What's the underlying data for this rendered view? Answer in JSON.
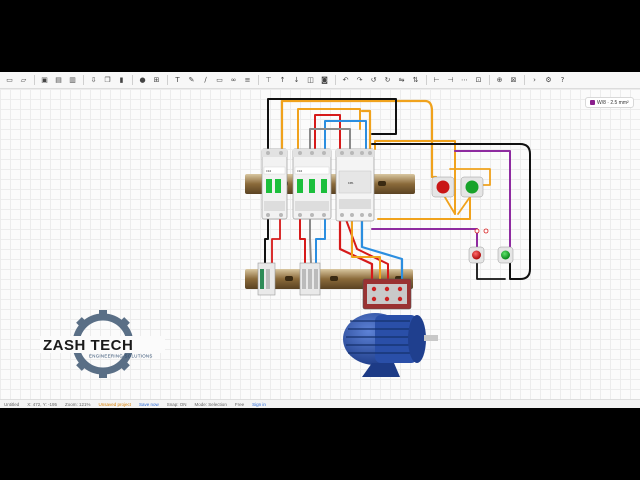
{
  "toolbar": {
    "buttons": [
      {
        "icon": "new-file-icon",
        "glyph": "▭"
      },
      {
        "icon": "open-folder-icon",
        "glyph": "▱"
      },
      {
        "icon": "save-icon",
        "glyph": "▣"
      },
      {
        "icon": "save-as-icon",
        "glyph": "▤"
      },
      {
        "icon": "export-icon",
        "glyph": "▥"
      },
      {
        "icon": "download-icon",
        "glyph": "⇩"
      },
      {
        "icon": "copy-icon",
        "glyph": "❐"
      },
      {
        "icon": "delete-icon",
        "glyph": "▮"
      },
      {
        "icon": "add-component-icon",
        "glyph": "●"
      },
      {
        "icon": "grid-icon",
        "glyph": "⊞"
      },
      {
        "icon": "text-tool-icon",
        "glyph": "T"
      },
      {
        "icon": "pen-tool-icon",
        "glyph": "✎"
      },
      {
        "icon": "line-tool-icon",
        "glyph": "∕"
      },
      {
        "icon": "shape-tool-icon",
        "glyph": "▭"
      },
      {
        "icon": "link-icon",
        "glyph": "∞"
      },
      {
        "icon": "layers-icon",
        "glyph": "≡"
      },
      {
        "icon": "filter-icon",
        "glyph": "⊤"
      },
      {
        "icon": "bring-forward-icon",
        "glyph": "↑"
      },
      {
        "icon": "send-backward-icon",
        "glyph": "↓"
      },
      {
        "icon": "unlock-icon",
        "glyph": "◫"
      },
      {
        "icon": "lock-icon",
        "glyph": "◙"
      },
      {
        "icon": "undo-icon",
        "glyph": "↶"
      },
      {
        "icon": "redo-icon",
        "glyph": "↷"
      },
      {
        "icon": "rotate-left-icon",
        "glyph": "↺"
      },
      {
        "icon": "rotate-right-icon",
        "glyph": "↻"
      },
      {
        "icon": "flip-horizontal-icon",
        "glyph": "⇋"
      },
      {
        "icon": "flip-vertical-icon",
        "glyph": "⇅"
      },
      {
        "icon": "align-left-icon",
        "glyph": "⊢"
      },
      {
        "icon": "align-right-icon",
        "glyph": "⊣"
      },
      {
        "icon": "distribute-icon",
        "glyph": "⋯"
      },
      {
        "icon": "group-icon",
        "glyph": "⊡"
      },
      {
        "icon": "zoom-in-icon",
        "glyph": "⊕"
      },
      {
        "icon": "zoom-fit-icon",
        "glyph": "⊠"
      },
      {
        "icon": "play-icon",
        "glyph": "›"
      },
      {
        "icon": "settings-icon",
        "glyph": "⚙"
      },
      {
        "icon": "help-icon",
        "glyph": "?"
      }
    ],
    "separators_after": [
      1,
      4,
      7,
      9,
      15,
      20,
      26,
      30,
      32
    ]
  },
  "wire_badge": {
    "label": "W/8 · 2.5 mm²",
    "color": "#8a1f8c"
  },
  "logo": {
    "title": "ZASH TECH",
    "subtitle": "ENGINEERING SOLUTIONS",
    "gear_color": "#5a6f86"
  },
  "components": {
    "mcb_rating": "C16",
    "contactor_label": "KM1",
    "push_button_colors": [
      "#c91515",
      "#17a32a"
    ],
    "motor_color": "#2a4fa8"
  },
  "wire_colors": {
    "phase_l1": "#b5651d",
    "phase_l2": "#1c1c1c",
    "phase_l3": "#8a8a8a",
    "red": "#d61a1a",
    "blue": "#2b8ee0",
    "orange": "#f0a21c",
    "purple": "#8e2ba0",
    "black": "#111111"
  },
  "status_bar": {
    "file": "Untitled",
    "coords": "X: 472, Y: -195",
    "zoom": "Zoom: 121%",
    "warning": "Unsaved project",
    "save": "Save now",
    "snap": "Snap: ON",
    "mode": "Mode: Selection",
    "plan": "Free",
    "signin": "Sign in"
  }
}
